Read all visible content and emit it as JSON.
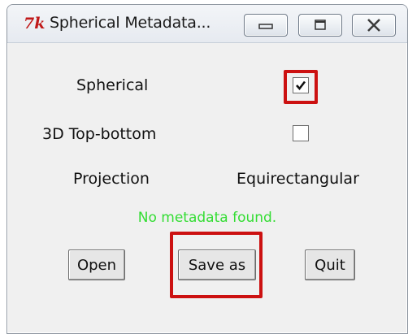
{
  "window": {
    "title": "Spherical Metadata...",
    "app_icon": "tk-feather-icon",
    "controls": {
      "minimize_icon": "minimize-icon",
      "maximize_icon": "maximize-icon",
      "close_icon": "close-icon"
    }
  },
  "fields": {
    "spherical_label": "Spherical",
    "spherical_checked": true,
    "topbottom_label": "3D Top-bottom",
    "topbottom_checked": false,
    "projection_label": "Projection",
    "projection_value": "Equirectangular"
  },
  "status": {
    "text": "No metadata found.",
    "color": "#33dd33"
  },
  "buttons": {
    "open": "Open",
    "save_as": "Save as",
    "quit": "Quit"
  },
  "colors": {
    "highlight": "#cc1111",
    "window_bg": "#f0f0f0"
  }
}
